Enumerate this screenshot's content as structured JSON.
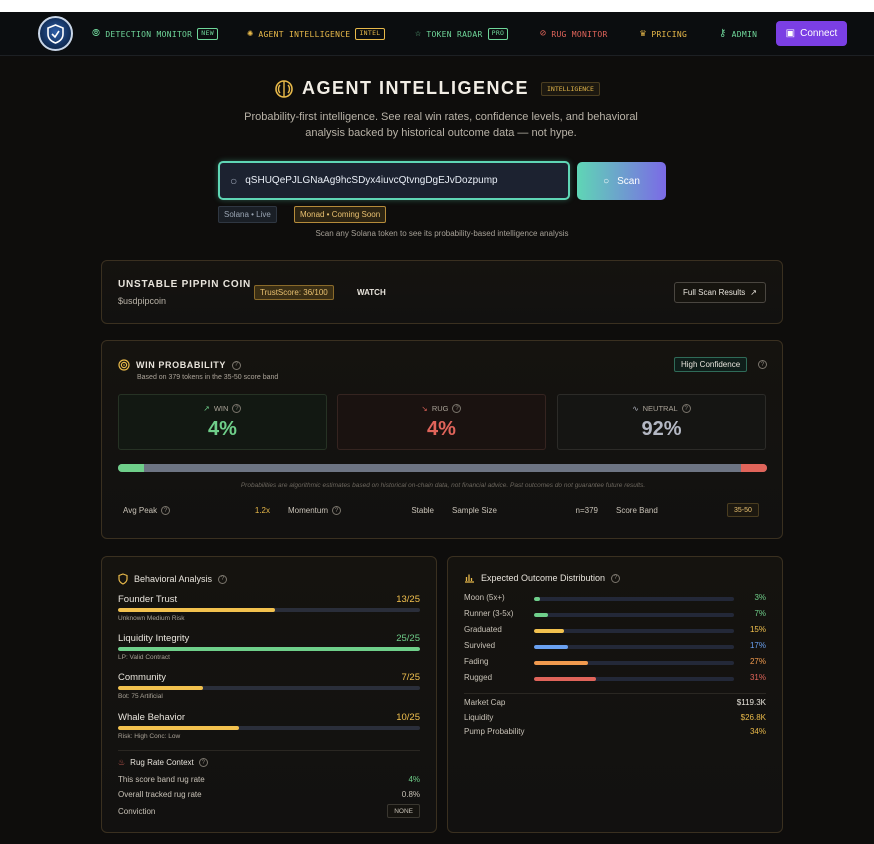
{
  "nav": {
    "items": [
      {
        "label": "DETECTION MONITOR",
        "badge": "NEW",
        "icon": "fingerprint-icon",
        "color": "#6fd69a"
      },
      {
        "label": "AGENT INTELLIGENCE",
        "badge": "INTEL",
        "icon": "brain-icon",
        "color": "#e8b94a"
      },
      {
        "label": "TOKEN RADAR",
        "badge": "PRO",
        "icon": "star-icon",
        "color": "#6fd69a"
      },
      {
        "label": "RUG MONITOR",
        "badge": "",
        "icon": "alert-icon",
        "color": "#e0645a"
      },
      {
        "label": "PRICING",
        "badge": "",
        "icon": "crown-icon",
        "color": "#e8b94a"
      },
      {
        "label": "ADMIN",
        "badge": "",
        "icon": "key-icon",
        "color": "#6fd69a"
      }
    ],
    "connect_label": "Connect"
  },
  "header": {
    "title": "AGENT INTELLIGENCE",
    "badge": "INTELLIGENCE",
    "subtitle": "Probability-first intelligence. See real win rates, confidence levels, and behavioral analysis backed by historical outcome data — not hype."
  },
  "search": {
    "value": "qSHUQePJLGNaAg9hcSDyx4iuvcQtvngDgEJvDozpump",
    "scan_label": "Scan",
    "chips": [
      "Solana • Live",
      "Monad • Coming Soon"
    ],
    "hint": "Scan any Solana token to see its probability-based intelligence analysis"
  },
  "token": {
    "name": "UNSTABLE PIPPIN COIN",
    "symbol": "$usdpipcoin",
    "trust_score": "TrustScore: 36/100",
    "status": "WATCH",
    "full_scan_label": "Full Scan Results"
  },
  "win_probability": {
    "title": "WIN PROBABILITY",
    "subtitle": "Based on 379 tokens in the 35-50 score band",
    "confidence": "High Confidence",
    "win_label": "WIN",
    "win_value": "4%",
    "win_pct": 4,
    "rug_label": "RUG",
    "rug_value": "4%",
    "rug_pct": 4,
    "neutral_label": "NEUTRAL",
    "neutral_value": "92%",
    "neutral_pct": 92,
    "disclaimer": "Probabilities are algorithmic estimates based on historical on-chain data, not financial advice. Past outcomes do not guarantee future results.",
    "stats": [
      {
        "label": "Avg Peak",
        "value": "1.2x"
      },
      {
        "label": "Momentum",
        "value": "Stable"
      },
      {
        "label": "Sample Size",
        "value": "n=379"
      },
      {
        "label": "Score Band",
        "value": "35-50"
      }
    ]
  },
  "behavioral": {
    "title": "Behavioral Analysis",
    "rows": [
      {
        "name": "Founder Trust",
        "score": "13/25",
        "pct": 52,
        "note": "Unknown Medium Risk",
        "color": "#f2c14e"
      },
      {
        "name": "Liquidity Integrity",
        "score": "25/25",
        "pct": 100,
        "note": "LP: Valid Contract",
        "color": "#6fcf8a"
      },
      {
        "name": "Community",
        "score": "7/25",
        "pct": 28,
        "note": "Bot: 75 Artificial",
        "color": "#f2c14e"
      },
      {
        "name": "Whale Behavior",
        "score": "10/25",
        "pct": 40,
        "note": "Risk: High Conc: Low",
        "color": "#f2c14e"
      }
    ],
    "rug_context": {
      "title": "Rug Rate Context",
      "rows": [
        {
          "label": "This score band rug rate",
          "value": "4%"
        },
        {
          "label": "Overall tracked rug rate",
          "value": "0.8%"
        }
      ],
      "conviction_label": "Conviction",
      "conviction_value": "NONE"
    }
  },
  "outcome": {
    "title": "Expected Outcome Distribution",
    "rows": [
      {
        "name": "Moon (5x+)",
        "pct": 3,
        "label": "3%",
        "color": "#6fcf8a"
      },
      {
        "name": "Runner (3-5x)",
        "pct": 7,
        "label": "7%",
        "color": "#6fcf8a"
      },
      {
        "name": "Graduated",
        "pct": 15,
        "label": "15%",
        "color": "#f2c14e"
      },
      {
        "name": "Survived",
        "pct": 17,
        "label": "17%",
        "color": "#6aa0f0"
      },
      {
        "name": "Fading",
        "pct": 27,
        "label": "27%",
        "color": "#f29a4e"
      },
      {
        "name": "Rugged",
        "pct": 31,
        "label": "31%",
        "color": "#e0645a"
      }
    ],
    "market": [
      {
        "label": "Market Cap",
        "value": "$119.3K"
      },
      {
        "label": "Liquidity",
        "value": "$26.8K"
      },
      {
        "label": "Pump Probability",
        "value": "34%"
      }
    ]
  }
}
